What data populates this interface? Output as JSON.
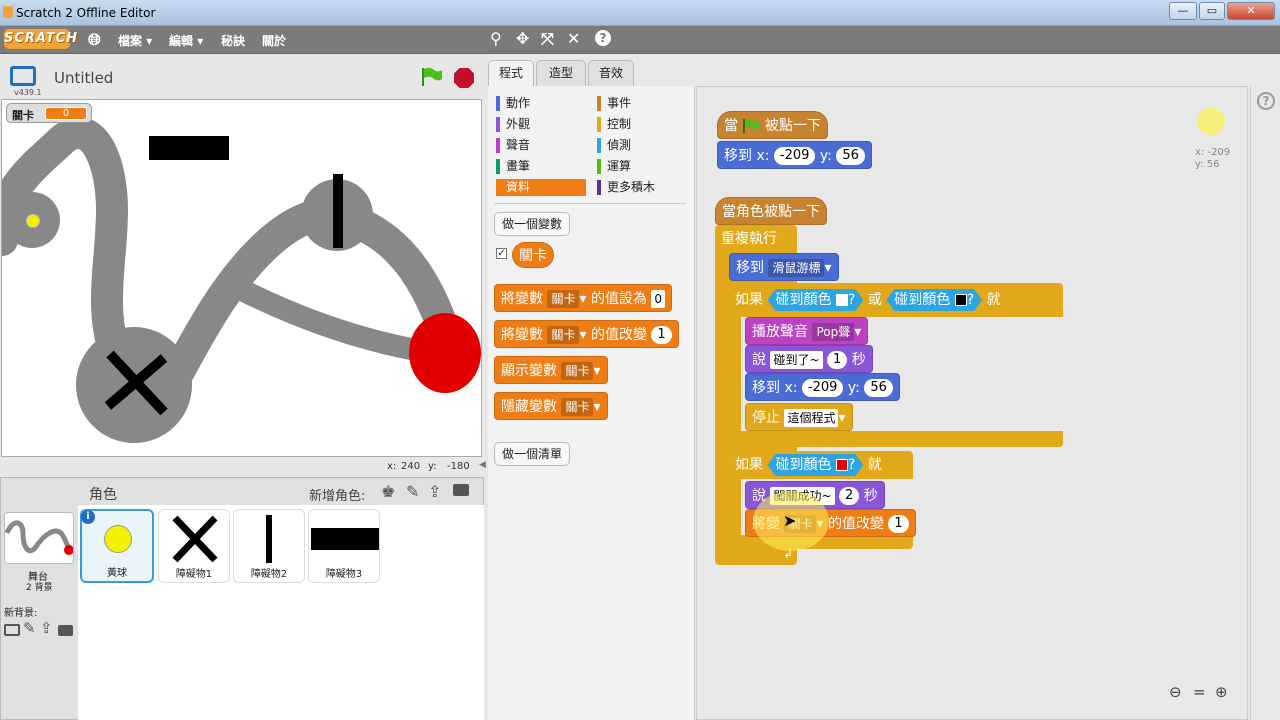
{
  "window": {
    "title": "Scratch 2 Offline Editor",
    "buttons": [
      "—",
      "▭",
      "✕"
    ]
  },
  "menubar": {
    "logo": "SCRATCH",
    "items": [
      "檔案",
      "編輯",
      "秘訣",
      "關於"
    ]
  },
  "toolbar_icons": [
    "duplicate-icon",
    "cut-icon",
    "grow-icon",
    "shrink-icon",
    "help-icon"
  ],
  "stage": {
    "project_title": "Untitled",
    "version": "v439.1",
    "variable_monitor": {
      "label": "關卡",
      "value": "0"
    },
    "mouse_x_label": "x:",
    "mouse_x": "240",
    "mouse_y_label": "y:",
    "mouse_y": "-180"
  },
  "sprites_panel": {
    "header": "角色",
    "new_sprite_label": "新增角色:",
    "stage_label": "舞台",
    "stage_backdrops": "2 背景",
    "new_backdrop_label": "新背景:",
    "sprites": [
      {
        "name": "黃球"
      },
      {
        "name": "障礙物1"
      },
      {
        "name": "障礙物2"
      },
      {
        "name": "障礙物3"
      }
    ]
  },
  "tabs": [
    "程式",
    "造型",
    "音效"
  ],
  "palette": {
    "categories_left": [
      "動作",
      "外觀",
      "聲音",
      "畫筆",
      "資料"
    ],
    "categories_right": [
      "事件",
      "控制",
      "偵測",
      "運算",
      "更多積木"
    ],
    "cat_colors_left": [
      "#4a6cd4",
      "#8a55d7",
      "#bb42c3",
      "#0e9a6c",
      "#ee7d16"
    ],
    "cat_colors_right": [
      "#c88330",
      "#e1a91a",
      "#2ca5e2",
      "#5cb712",
      "#632d99"
    ],
    "make_variable": "做一個變數",
    "variable_name": "關卡",
    "set_var": {
      "pre": "將變數",
      "var": "關卡",
      "mid": "的值設為",
      "val": "0"
    },
    "change_var": {
      "pre": "將變數",
      "var": "關卡",
      "mid": "的值改變",
      "val": "1"
    },
    "show_var": {
      "pre": "顯示變數",
      "var": "關卡"
    },
    "hide_var": {
      "pre": "隱藏變數",
      "var": "關卡"
    },
    "make_list": "做一個清單"
  },
  "scripts": {
    "hat1": {
      "pre": "當",
      "post": "被點一下"
    },
    "goto1": {
      "pre": "移到 x:",
      "x": "-209",
      "ylbl": "y:",
      "y": "56"
    },
    "hat2": "當角色被點一下",
    "forever": "重複執行",
    "goto_mouse": {
      "pre": "移到",
      "target": "滑鼠游標"
    },
    "if1": {
      "pre": "如果",
      "touch": "碰到顏色",
      "q": "?",
      "or": "或",
      "touch2": "碰到顏色",
      "q2": "?",
      "then": "就"
    },
    "play": {
      "pre": "播放聲音",
      "sound": "Pop聲"
    },
    "say1": {
      "pre": "說",
      "text": "碰到了~",
      "secs": "1",
      "post": "秒"
    },
    "goto2": {
      "pre": "移到 x:",
      "x": "-209",
      "ylbl": "y:",
      "y": "56"
    },
    "stop": {
      "pre": "停止",
      "opt": "這個程式"
    },
    "if2": {
      "pre": "如果",
      "touch": "碰到顏色",
      "q": "?",
      "then": "就"
    },
    "say2": {
      "pre": "說",
      "text": "闖關成功~",
      "secs": "2",
      "post": "秒"
    },
    "change": {
      "pre": "將變",
      "var": "關卡",
      "mid": "的值改變",
      "val": "1"
    },
    "sprite_x": "x: -209",
    "sprite_y": "y: 56"
  }
}
